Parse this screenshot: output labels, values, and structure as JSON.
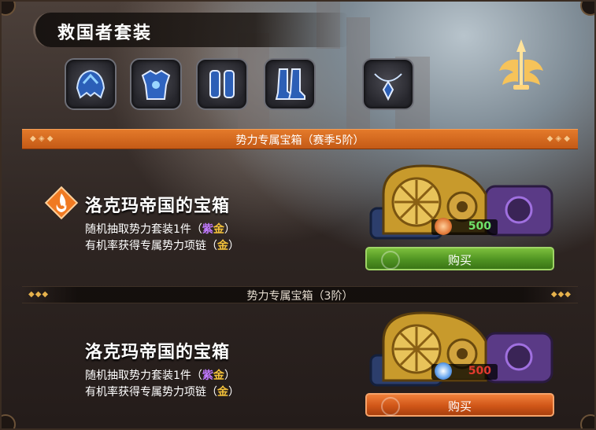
{
  "set_title": "救国者套装",
  "equipment_slots": [
    {
      "name": "helmet-icon"
    },
    {
      "name": "armor-icon"
    },
    {
      "name": "gloves-icon"
    },
    {
      "name": "boots-icon"
    },
    {
      "name": "necklace-icon"
    }
  ],
  "faction_emblem": "winged-sword-emblem-icon",
  "section1": {
    "header": "势力专属宝箱（赛季5阶）",
    "chest_name": "洛克玛帝国的宝箱",
    "desc_line1_prefix": "随机抽取势力套装1件（",
    "desc_line1_purple": "紫",
    "desc_line1_gold": "金",
    "desc_line1_suffix": "）",
    "desc_line2_prefix": "有机率获得专属势力项链（",
    "desc_line2_gold": "金",
    "desc_line2_suffix": "）",
    "price": "500",
    "price_color": "#6fe26a",
    "currency_icon": "flower-token-icon",
    "buy_label": "购买",
    "button_color": "#4f9322"
  },
  "section2": {
    "header": "势力专属宝箱（3阶）",
    "chest_name": "洛克玛帝国的宝箱",
    "desc_line1_prefix": "随机抽取势力套装1件（",
    "desc_line1_purple": "紫",
    "desc_line1_gold": "金",
    "desc_line1_suffix": "）",
    "desc_line2_prefix": "有机率获得专属势力项链（",
    "desc_line2_gold": "金",
    "desc_line2_suffix": "）",
    "price": "500",
    "price_color": "#e23a2e",
    "currency_icon": "blue-medal-icon",
    "buy_label": "购买",
    "button_color": "#d05618"
  }
}
